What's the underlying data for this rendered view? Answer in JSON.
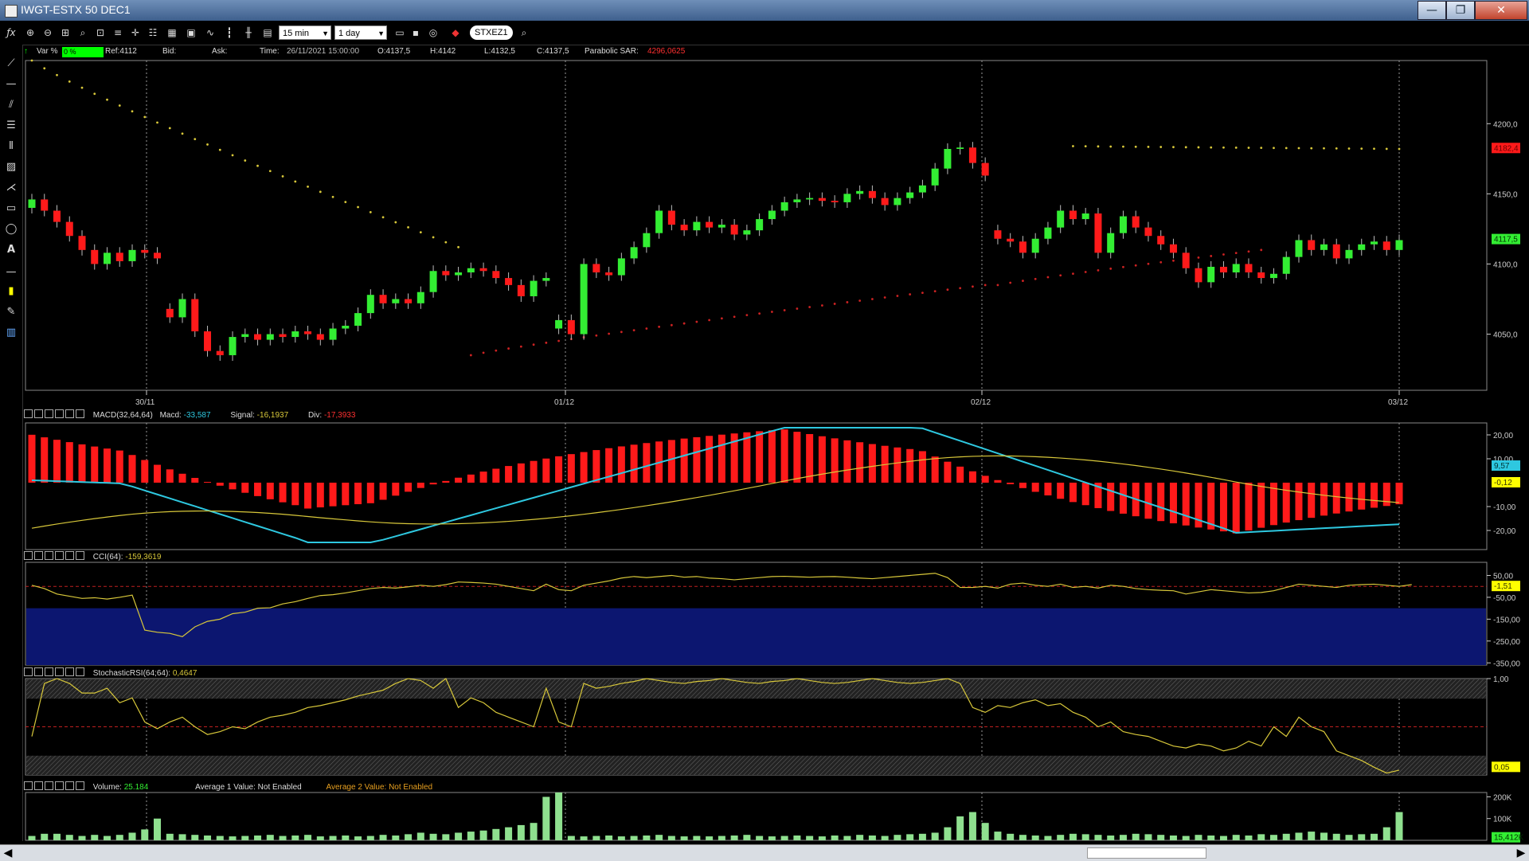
{
  "window": {
    "title": "IWGT-ESTX 50 DEC1",
    "min": "—",
    "restore": "❐",
    "close": "✕"
  },
  "toolbar": {
    "fx": "ƒx",
    "timeframe": "15 min",
    "period": "1 day",
    "symbol": "STXEZ1"
  },
  "info": {
    "var_label": "Var %",
    "var_value": "0 %",
    "ref": "Ref:4112",
    "bid": "Bid:",
    "ask": "Ask:",
    "time": "Time:",
    "time_value": "26/11/2021 15:00:00",
    "open": "O:4137,5",
    "high": "H:4142",
    "low": "L:4132,5",
    "close": "C:4137,5",
    "sar_label": "Parabolic SAR:",
    "sar_value": "4296,0625"
  },
  "colors": {
    "up": "#33ee33",
    "down": "#ff1a1a",
    "sar_up": "#d8c83a",
    "sar_down": "#cc2222",
    "macd": "#2ec8e0",
    "signal": "#d8c83a",
    "axis": "#cccccc",
    "cci_band": "#0c1670"
  },
  "chart_data": [
    {
      "type": "candlestick",
      "title": "IWGT-ESTX 50 DEC1",
      "x_tick_labels": [
        "30/11",
        "01/12",
        "02/12",
        "03/12"
      ],
      "y_tick_labels": [
        "4200,0",
        "4150,0",
        "4100,0",
        "4050,0"
      ],
      "ylim": [
        4010,
        4245
      ],
      "last_price_label": "4117,5",
      "sar_label": "4182,4",
      "close": [
        4146,
        4138,
        4130,
        4120,
        4110,
        4100,
        4108,
        4102,
        4110,
        4108,
        4104,
        4062,
        4075,
        4052,
        4038,
        4035,
        4048,
        4050,
        4046,
        4050,
        4048,
        4052,
        4050,
        4046,
        4054,
        4056,
        4065,
        4078,
        4072,
        4075,
        4072,
        4080,
        4095,
        4092,
        4094,
        4097,
        4095,
        4090,
        4085,
        4077,
        4088,
        4090,
        4060,
        4050,
        4100,
        4094,
        4092,
        4104,
        4112,
        4122,
        4138,
        4128,
        4124,
        4130,
        4126,
        4128,
        4121,
        4124,
        4132,
        4138,
        4144,
        4146,
        4147,
        4145,
        4144,
        4150,
        4152,
        4147,
        4142,
        4147,
        4151,
        4156,
        4168,
        4182,
        4183,
        4172,
        4163,
        4118,
        4116,
        4108,
        4118,
        4126,
        4138,
        4132,
        4136,
        4108,
        4122,
        4134,
        4126,
        4120,
        4114,
        4108,
        4097,
        4087,
        4098,
        4094,
        4100,
        4094,
        4090,
        4093,
        4105,
        4117,
        4110,
        4114,
        4104,
        4110,
        4114,
        4116,
        4110,
        4117
      ]
    },
    {
      "type": "bar",
      "title": "MACD(32,64,64)",
      "macd_label": "Macd:",
      "macd_value": "-33,587",
      "signal_label": "Signal:",
      "signal_value": "-16,1937",
      "div_label": "Div:",
      "div_value": "-17,3933",
      "y_tick_labels": [
        "20,00",
        "10,00",
        "-10,00",
        "-20,00"
      ],
      "ylim": [
        -28,
        25
      ],
      "current_labels": [
        "9,57",
        "-0,12"
      ]
    },
    {
      "type": "line",
      "title": "CCI(64):",
      "value": "-159,3619",
      "y_tick_labels": [
        "50,00",
        "-50,00",
        "-150,00",
        "-250,00",
        "-350,00"
      ],
      "ylim": [
        -360,
        110
      ],
      "current_label": "-1,51",
      "values": [
        5,
        -10,
        -35,
        -45,
        -55,
        -52,
        -58,
        -50,
        -40,
        -200,
        -210,
        -215,
        -230,
        -185,
        -160,
        -150,
        -125,
        -118,
        -100,
        -98,
        -80,
        -70,
        -55,
        -42,
        -38,
        -30,
        -20,
        -10,
        -5,
        -8,
        -2,
        5,
        0,
        8,
        20,
        18,
        15,
        10,
        0,
        -10,
        -20,
        10,
        -15,
        -20,
        5,
        15,
        25,
        38,
        45,
        40,
        45,
        50,
        42,
        45,
        38,
        35,
        30,
        35,
        40,
        45,
        46,
        44,
        42,
        44,
        45,
        42,
        38,
        35,
        40,
        45,
        50,
        55,
        60,
        40,
        -5,
        -5,
        0,
        -8,
        10,
        15,
        5,
        0,
        10,
        -5,
        0,
        -8,
        5,
        0,
        -10,
        -15,
        -18,
        -20,
        -35,
        -25,
        -15,
        -20,
        -25,
        -30,
        -28,
        -20,
        -5,
        10,
        5,
        0,
        -5,
        5,
        8,
        10,
        5,
        0,
        8
      ]
    },
    {
      "type": "line",
      "title": "StochasticRSI(64;64):",
      "value": "0,4647",
      "y_tick_labels": [
        "1,00"
      ],
      "ylim": [
        0,
        1
      ],
      "current_label": "0,05",
      "values": [
        0.4,
        0.95,
        1.0,
        0.95,
        0.85,
        0.85,
        0.9,
        0.75,
        0.8,
        0.55,
        0.48,
        0.55,
        0.6,
        0.5,
        0.42,
        0.45,
        0.5,
        0.48,
        0.55,
        0.6,
        0.62,
        0.65,
        0.7,
        0.72,
        0.75,
        0.78,
        0.82,
        0.85,
        0.88,
        0.95,
        1.0,
        0.98,
        0.9,
        1.0,
        0.7,
        0.8,
        0.75,
        0.65,
        0.6,
        0.55,
        0.5,
        0.9,
        0.55,
        0.5,
        0.95,
        0.9,
        0.92,
        0.95,
        0.97,
        1.0,
        0.98,
        0.96,
        0.95,
        0.97,
        0.98,
        1.0,
        0.98,
        0.96,
        0.95,
        0.97,
        0.98,
        1.0,
        0.98,
        0.96,
        0.95,
        0.96,
        0.98,
        1.0,
        0.98,
        0.96,
        0.95,
        0.96,
        0.98,
        1.0,
        0.95,
        0.7,
        0.65,
        0.72,
        0.7,
        0.75,
        0.78,
        0.72,
        0.74,
        0.65,
        0.6,
        0.5,
        0.55,
        0.45,
        0.42,
        0.4,
        0.35,
        0.3,
        0.28,
        0.32,
        0.3,
        0.25,
        0.28,
        0.35,
        0.3,
        0.5,
        0.4,
        0.6,
        0.5,
        0.45,
        0.25,
        0.2,
        0.15,
        0.08,
        0.02,
        0.05
      ]
    },
    {
      "type": "bar",
      "title": "Volume:",
      "value": "25.184",
      "avg1_label": "Average 1 Value:",
      "avg1_value": "Not Enabled",
      "avg2_label": "Average 2 Value:",
      "avg2_value": "Not Enabled",
      "y_tick_labels": [
        "200K",
        "100K"
      ],
      "ylim": [
        0,
        220000
      ],
      "current_label": "15,412K",
      "values": [
        20000,
        30000,
        30000,
        25000,
        20000,
        25000,
        20000,
        25000,
        35000,
        50000,
        100000,
        30000,
        28000,
        25000,
        22000,
        20000,
        18000,
        20000,
        22000,
        25000,
        20000,
        22000,
        25000,
        18000,
        20000,
        22000,
        18000,
        20000,
        25000,
        22000,
        28000,
        35000,
        30000,
        28000,
        35000,
        40000,
        45000,
        52000,
        60000,
        70000,
        80000,
        200000,
        230000,
        20000,
        18000,
        20000,
        22000,
        18000,
        20000,
        22000,
        25000,
        20000,
        18000,
        20000,
        18000,
        20000,
        22000,
        25000,
        20000,
        18000,
        20000,
        22000,
        20000,
        18000,
        22000,
        20000,
        25000,
        22000,
        20000,
        25000,
        28000,
        30000,
        35000,
        60000,
        110000,
        130000,
        80000,
        40000,
        30000,
        25000,
        22000,
        20000,
        25000,
        30000,
        28000,
        25000,
        22000,
        25000,
        30000,
        28000,
        25000,
        22000,
        20000,
        25000,
        22000,
        20000,
        25000,
        22000,
        28000,
        25000,
        30000,
        35000,
        40000,
        35000,
        30000,
        25000,
        28000,
        30000,
        60000,
        130000
      ]
    }
  ]
}
